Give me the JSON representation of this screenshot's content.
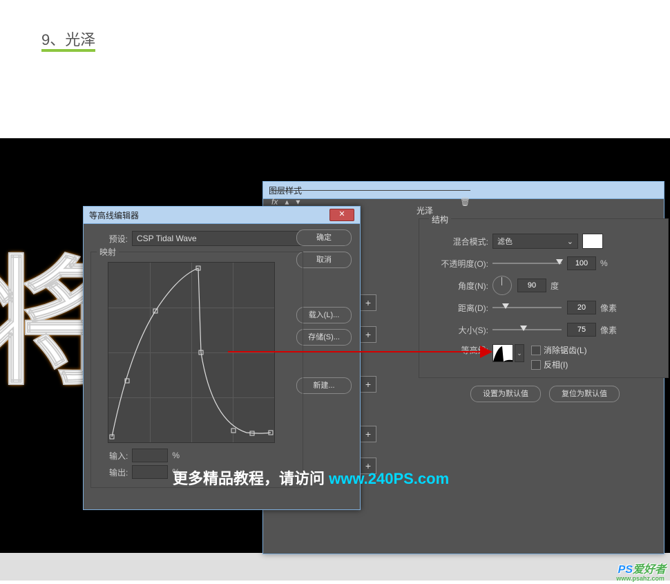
{
  "page": {
    "step_title": "9、光泽"
  },
  "contour_editor": {
    "title": "等高线编辑器",
    "preset_label": "预设:",
    "preset_value": "CSP Tidal Wave",
    "mapping_label": "映射",
    "input_label": "输入:",
    "input_unit": "%",
    "output_label": "输出:",
    "output_unit": "%",
    "buttons": {
      "ok": "确定",
      "cancel": "取消",
      "load": "载入(L)...",
      "save": "存储(S)...",
      "new": "新建..."
    }
  },
  "layer_style": {
    "title": "图层样式",
    "section": "光泽",
    "group": "结构",
    "blend_mode_label": "混合模式:",
    "blend_mode_value": "滤色",
    "opacity_label": "不透明度(O):",
    "opacity_value": "100",
    "opacity_unit": "%",
    "angle_label": "角度(N):",
    "angle_value": "90",
    "angle_unit": "度",
    "distance_label": "距离(D):",
    "distance_value": "20",
    "distance_unit": "像素",
    "size_label": "大小(S):",
    "size_value": "75",
    "size_unit": "像素",
    "contour_label": "等高线:",
    "antialias_label": "消除锯齿(L)",
    "invert_label": "反相(I)",
    "make_default": "设置为默认值",
    "reset_default": "复位为默认值",
    "fx_symbol": "fx",
    "trash_symbol": "🗑"
  },
  "plus_boxes": [
    "+",
    "+",
    "+",
    "+",
    "+"
  ],
  "watermark": {
    "text_prefix": "更多精品教程，请访问 ",
    "link": "www.240PS.com",
    "corner_ps": "PS",
    "corner_cn": "爱好者",
    "corner_url": "www.psahz.com"
  }
}
